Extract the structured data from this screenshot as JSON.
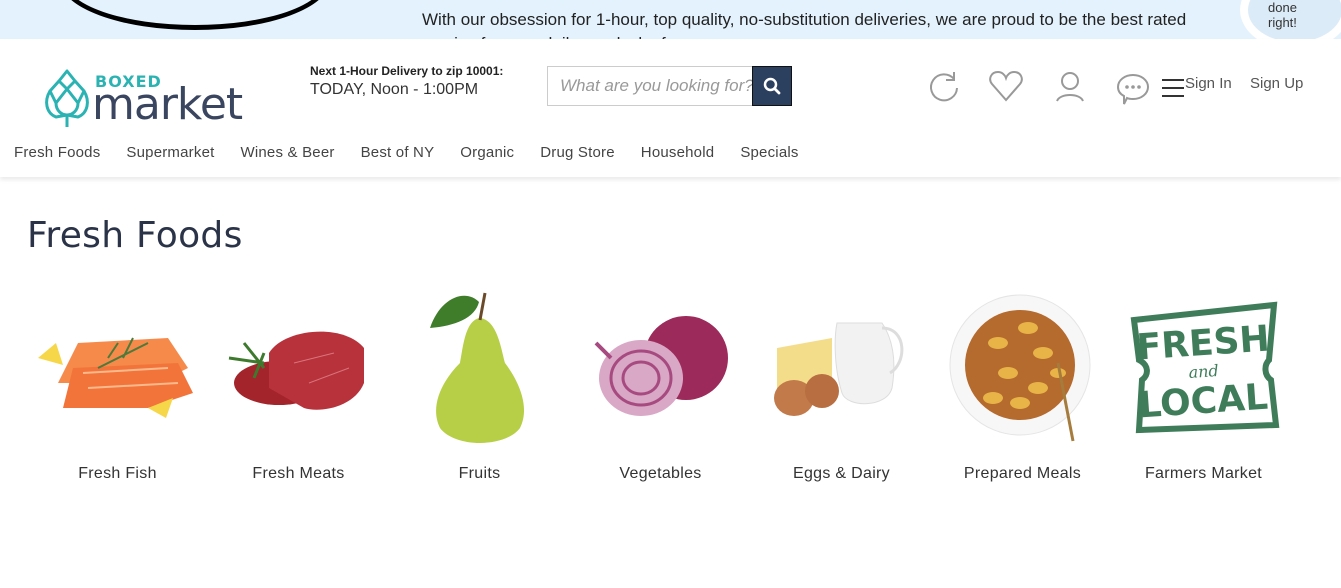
{
  "banner": {
    "text": "With our obsession for 1-hour, top quality, no-substitution deliveries, we are proud to be the best rated service for your daily needs, by far.",
    "badge_line1": "done",
    "badge_line2": "right!"
  },
  "header": {
    "logo_top": "BOXED",
    "logo_bottom": "market",
    "delivery_label": "Next 1-Hour Delivery to zip 10001:",
    "delivery_time": "TODAY, Noon - 1:00PM",
    "search_placeholder": "What are you looking for?",
    "search_value": "",
    "sign_in": "Sign In",
    "sign_up": "Sign Up",
    "icons": [
      "refresh-icon",
      "heart-icon",
      "user-icon",
      "chat-icon",
      "menu-icon"
    ]
  },
  "nav": {
    "items": [
      {
        "label": "Fresh Foods"
      },
      {
        "label": "Supermarket"
      },
      {
        "label": "Wines & Beer"
      },
      {
        "label": "Best of NY"
      },
      {
        "label": "Organic"
      },
      {
        "label": "Drug Store"
      },
      {
        "label": "Household"
      },
      {
        "label": "Specials"
      }
    ]
  },
  "main": {
    "title": "Fresh Foods",
    "categories": [
      {
        "label": "Fresh Fish",
        "image": "salmon-fillets"
      },
      {
        "label": "Fresh Meats",
        "image": "red-meat"
      },
      {
        "label": "Fruits",
        "image": "pear"
      },
      {
        "label": "Vegetables",
        "image": "red-onion"
      },
      {
        "label": "Eggs & Dairy",
        "image": "eggs-cheese-milk"
      },
      {
        "label": "Prepared Meals",
        "image": "pasta-bowl"
      },
      {
        "label": "Farmers Market",
        "image": "fresh-and-local-stamp"
      }
    ]
  },
  "colors": {
    "accent_teal": "#2ab3b2",
    "navy": "#2b3f5e",
    "banner_bg": "#e3f2fd",
    "stamp_green": "#3f7d5a"
  }
}
